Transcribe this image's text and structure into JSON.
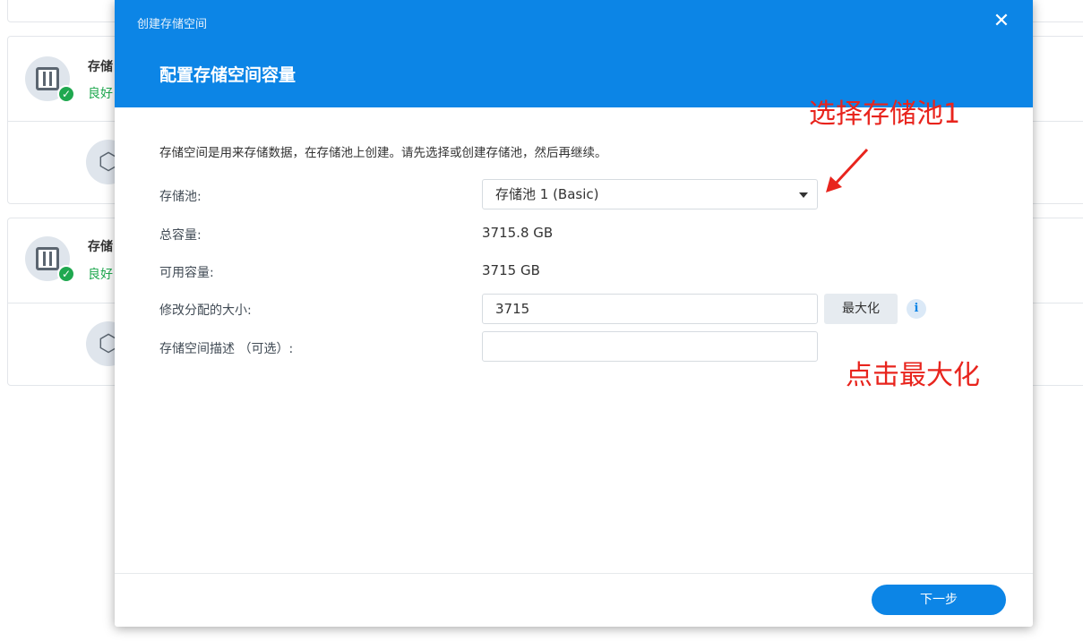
{
  "background": {
    "pools": [
      {
        "title": "存储",
        "status": "良好"
      },
      {
        "title": "存储",
        "status": "良好"
      }
    ]
  },
  "dialog": {
    "small_title": "创建存储空间",
    "close_glyph": "✕",
    "title": "配置存储空间容量",
    "description": "存储空间是用来存储数据，在存储池上创建。请先选择或创建存储池，然后再继续。",
    "fields": {
      "pool_label": "存储池:",
      "pool_value": "存储池 1 (Basic)",
      "total_label": "总容量:",
      "total_value": "3715.8 GB",
      "available_label": "可用容量:",
      "available_value": "3715 GB",
      "size_label": "修改分配的大小:",
      "size_value": "3715",
      "max_button": "最大化",
      "desc_label": "存储空间描述 （可选）:",
      "desc_value": ""
    },
    "next_button": "下一步"
  },
  "annotations": {
    "select_pool": "选择存储池1",
    "click_max": "点击最大化"
  },
  "colors": {
    "header_blue": "#0c85e6",
    "annotation_red": "#e8241d",
    "status_green": "#1fa84f"
  }
}
